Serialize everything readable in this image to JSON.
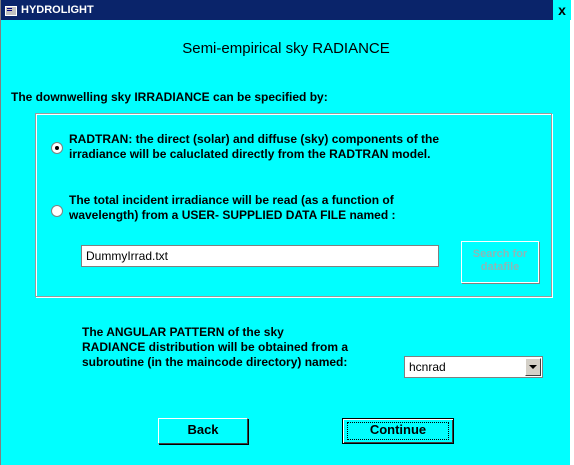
{
  "window": {
    "title": "HYDROLIGHT",
    "close_label": "x"
  },
  "heading": "Semi-empirical sky RADIANCE",
  "subheading": "The downwelling sky IRRADIANCE can be specified by:",
  "options": [
    {
      "line1": "RADTRAN:  the direct (solar) and diffuse (sky) components of the",
      "line2": "irradiance will be caluclated directly from the RADTRAN model.",
      "selected": true
    },
    {
      "line1": "The total incident irradiance will be read (as a function of",
      "line2": "wavelength) from a USER- SUPPLIED DATA FILE named :",
      "selected": false
    }
  ],
  "datafile": {
    "value": "DummyIrrad.txt",
    "search_line1": "Search for",
    "search_line2": "datafile"
  },
  "angular": {
    "line1": "The ANGULAR PATTERN of the sky",
    "line2": "RADIANCE distribution will be obtained from a",
    "line3": "subroutine (in the maincode directory) named:",
    "selected_value": "hcnrad"
  },
  "buttons": {
    "back": "Back",
    "continue": "Continue"
  },
  "colors": {
    "background": "#00ffff",
    "titlebar": "#0a246a"
  }
}
